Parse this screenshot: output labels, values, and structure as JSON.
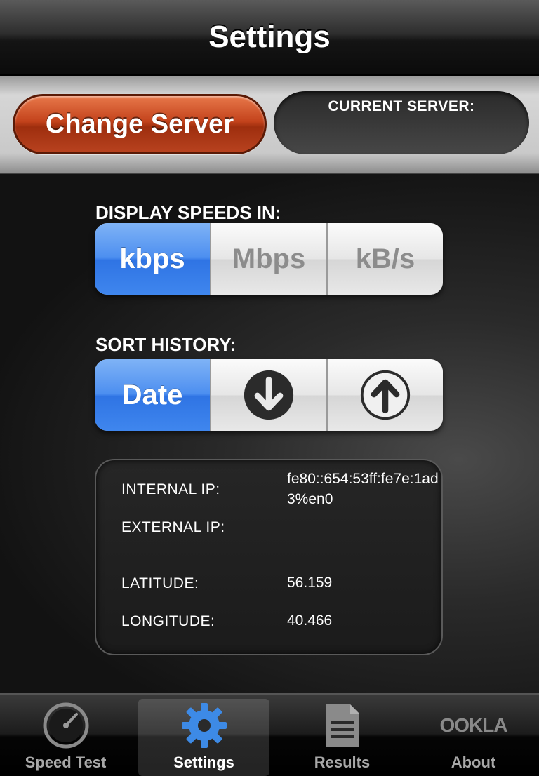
{
  "navbar": {
    "title": "Settings"
  },
  "server": {
    "change_label": "Change Server",
    "current_label": "CURRENT SERVER:",
    "current_value": ""
  },
  "speeds": {
    "label": "DISPLAY SPEEDS IN:",
    "options": [
      "kbps",
      "Mbps",
      "kB/s"
    ],
    "selected": "kbps"
  },
  "sort": {
    "label": "SORT HISTORY:",
    "options": [
      {
        "label": "Date",
        "icon": ""
      },
      {
        "label": "",
        "icon": "arrow-down-circle-icon"
      },
      {
        "label": "",
        "icon": "arrow-up-circle-icon"
      }
    ],
    "selected": "Date"
  },
  "network": {
    "internal_ip_label": "INTERNAL IP:",
    "internal_ip_value": "fe80::654:53ff:fe7e:1ad3%en0",
    "external_ip_label": "EXTERNAL IP:",
    "external_ip_value": "",
    "latitude_label": "LATITUDE:",
    "latitude_value": "56.159",
    "longitude_label": "LONGITUDE:",
    "longitude_value": "40.466"
  },
  "tabbar": {
    "tabs": [
      {
        "label": "Speed Test",
        "icon": "speedometer-icon"
      },
      {
        "label": "Settings",
        "icon": "gear-icon"
      },
      {
        "label": "Results",
        "icon": "document-icon"
      },
      {
        "label": "About",
        "icon": "ookla-logo-icon"
      }
    ],
    "active": "Settings",
    "about_logo_text": "OOKLA"
  },
  "colors": {
    "accent_blue": "#3f86ee",
    "change_server_red": "#c4431c",
    "settings_icon_blue": "#3d8ae6"
  }
}
